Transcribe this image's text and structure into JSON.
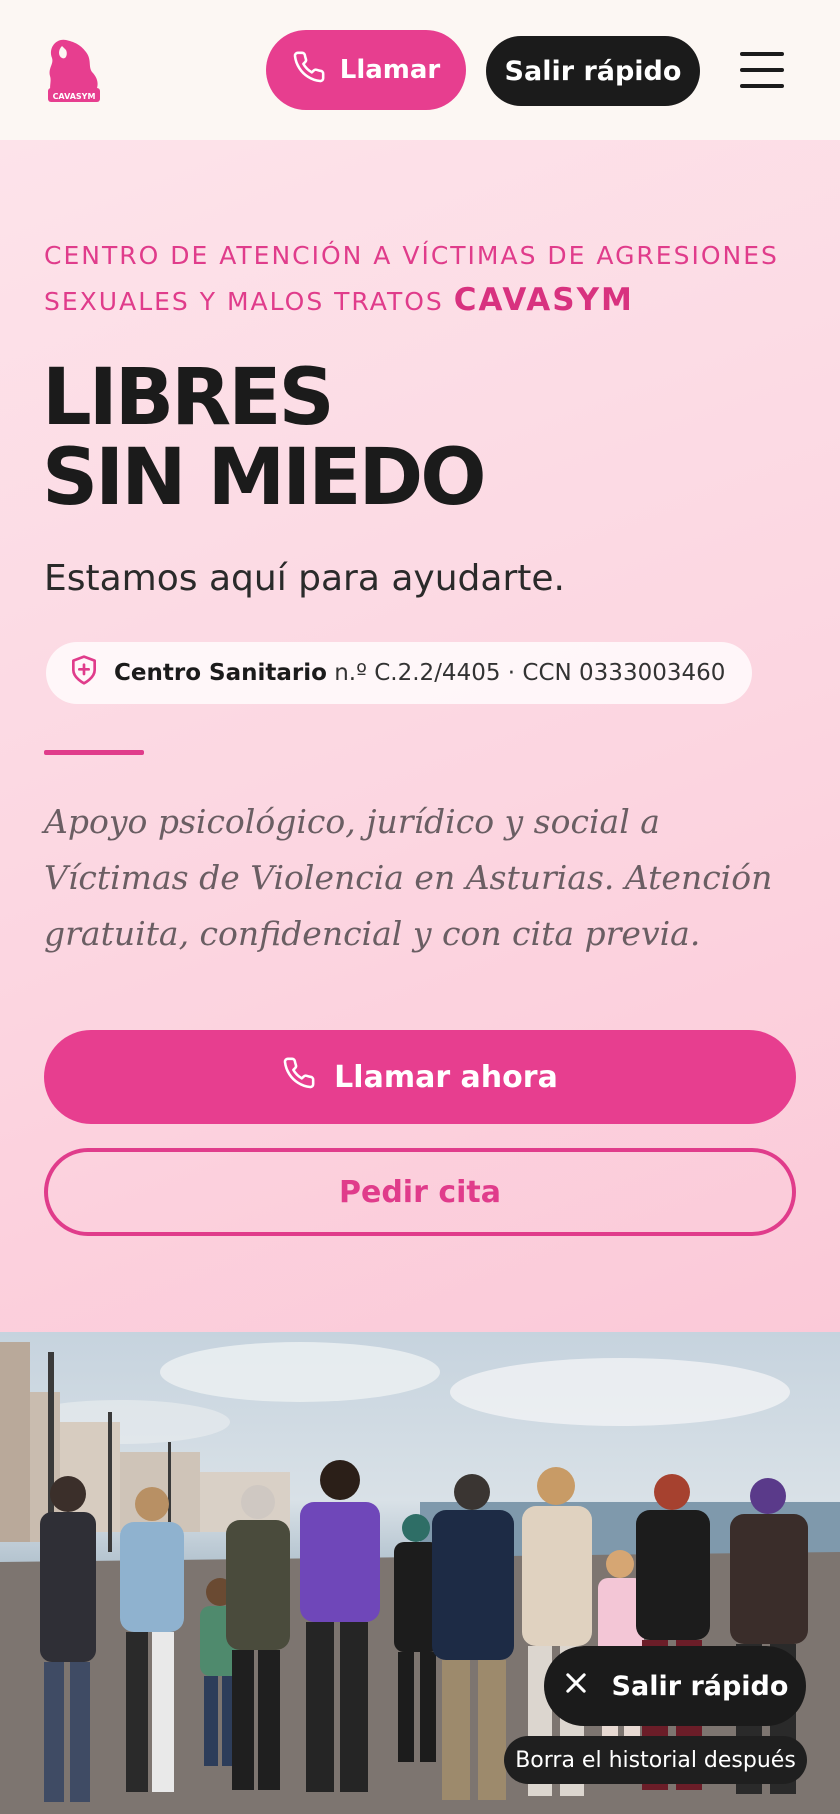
{
  "header": {
    "logo_text": "CAVASYM",
    "call_label": "Llamar",
    "quick_exit_label": "Salir rápido",
    "menu_icon": "hamburger-icon"
  },
  "hero": {
    "eyebrow_text": "Centro de atención a víctimas de agresiones sexuales y malos tratos",
    "eyebrow_brand": "CAVASYM",
    "headline_line1": "LIBRES",
    "headline_line2": "SIN MIEDO",
    "subtitle": "Estamos aquí para ayudarte.",
    "badge": {
      "icon": "shield-plus-icon",
      "label": "Centro Sanitario",
      "details": "n.º C.2.2/4405 · CCN 0333003460"
    },
    "description": "Apoyo psicológico, jurídico y social a Víctimas de Violencia en Asturias. Atención gratuita, confidencial y con cita previa.",
    "primary_cta": "Llamar ahora",
    "secondary_cta": "Pedir cita"
  },
  "floating": {
    "quick_exit_label": "Salir rápido",
    "hint": "Borra el historial después"
  },
  "colors": {
    "accent": "#e73e8f",
    "dark": "#1b1b1b",
    "hero_bg": "#fcd6e1"
  }
}
